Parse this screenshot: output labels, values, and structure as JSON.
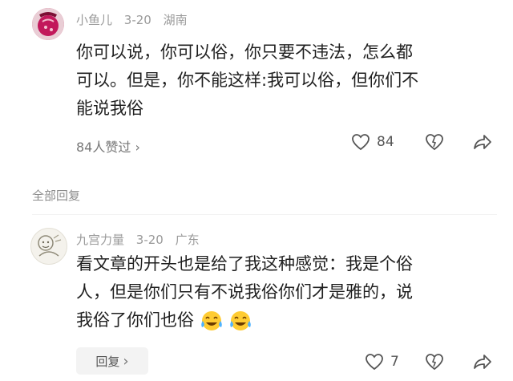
{
  "comment1": {
    "username": "小鱼儿",
    "date": "3-20",
    "location": "湖南",
    "lines": [
      "你可以说，你可以俗，你只要不违法，怎么都",
      "可以。但是，你不能这样:我可以俗，但你们不",
      "能说我俗"
    ],
    "liked_by": "84人赞过 ›",
    "like_count": "84"
  },
  "section": {
    "all_replies": "全部回复"
  },
  "comment2": {
    "username": "九宫力量",
    "date": "3-20",
    "location": "广东",
    "lines": [
      "看文章的开头也是给了我这种感觉：我是个俗",
      "人，但是你们只有不说我俗你们才是雅的，说",
      "我俗了你们也俗"
    ],
    "reply_label": "回复",
    "reply_chevron": "›",
    "like_count": "7"
  },
  "icons": [
    "heart-icon",
    "dislike-heart-icon",
    "share-icon",
    "laughing-emoji",
    "chevron-right-icon"
  ]
}
